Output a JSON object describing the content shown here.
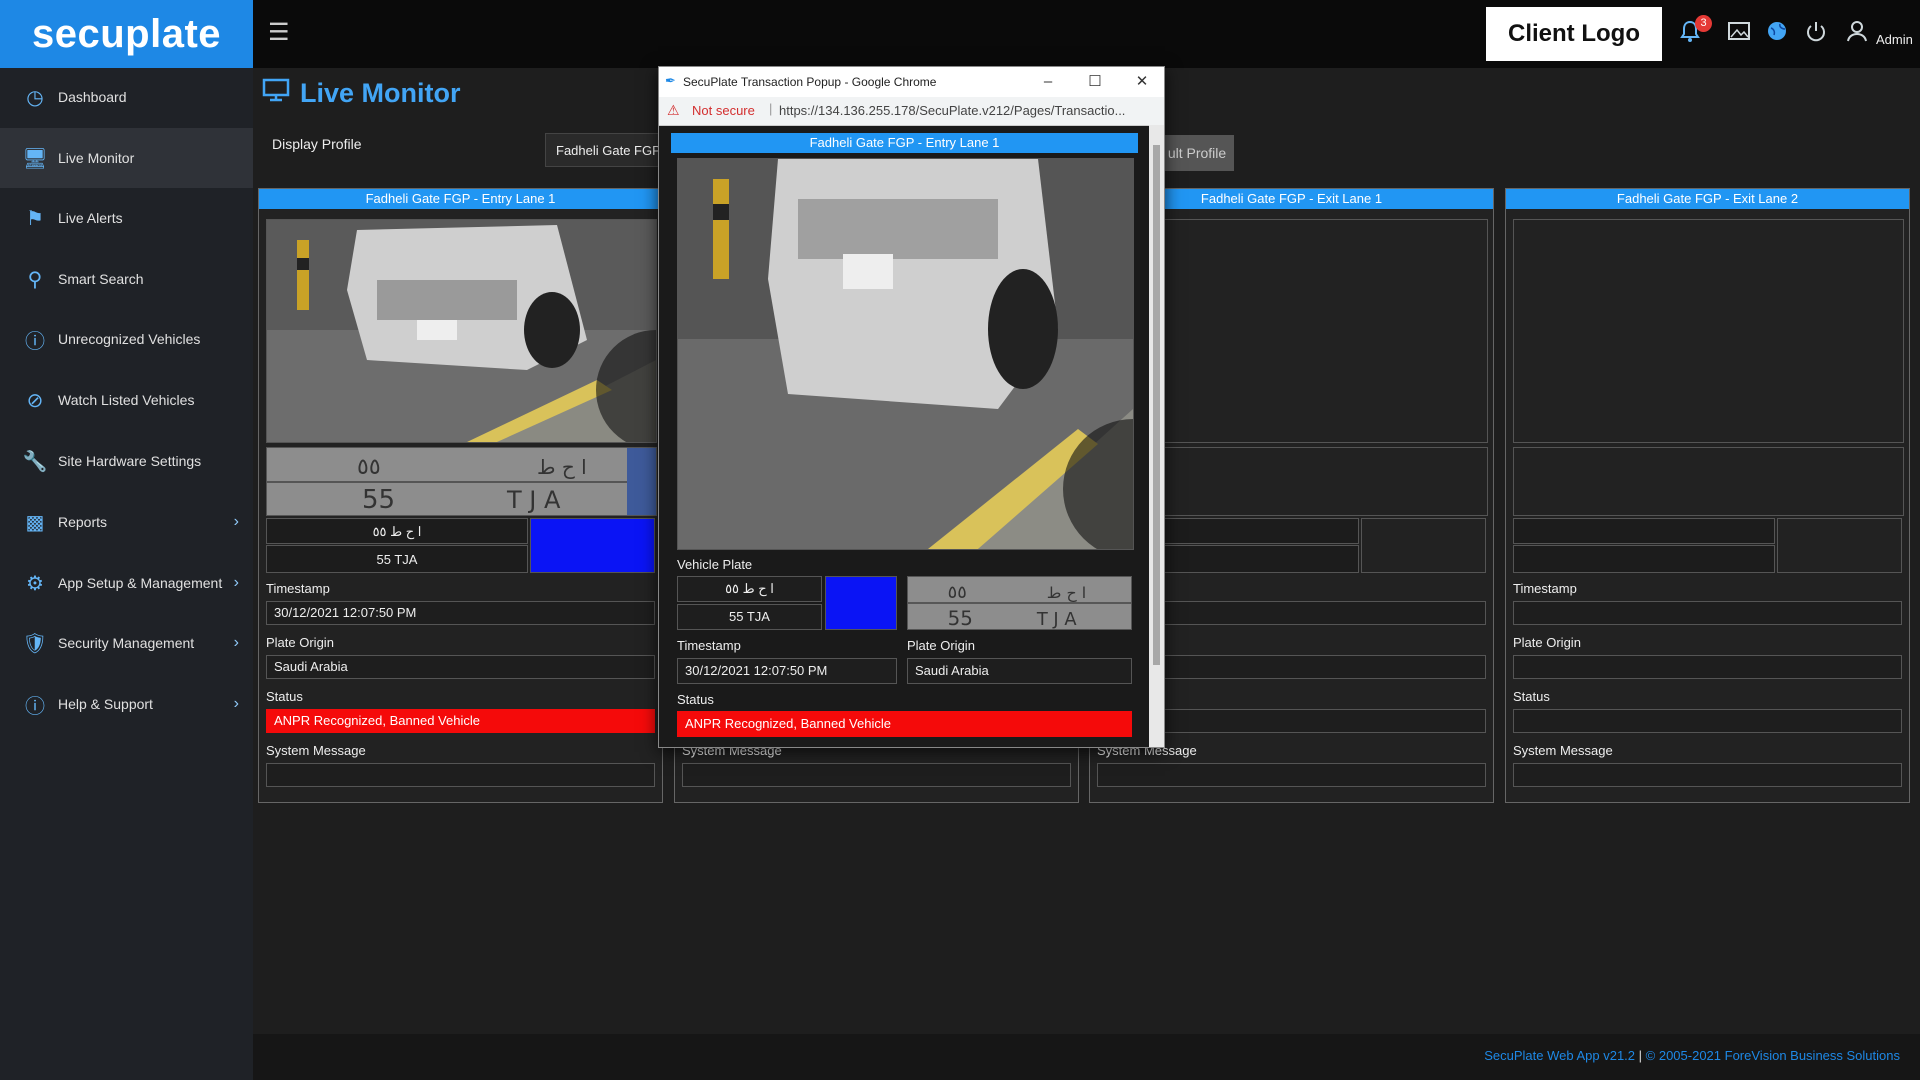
{
  "app": {
    "logo": "secuplate",
    "client_logo": "Client Logo",
    "notification_count": "3",
    "user_label": "Admin"
  },
  "sidebar": {
    "items": [
      {
        "label": "Dashboard",
        "icon": "dashboard-gauge-icon"
      },
      {
        "label": "Live Monitor",
        "icon": "monitor-icon",
        "active": true
      },
      {
        "label": "Live Alerts",
        "icon": "flag-icon"
      },
      {
        "label": "Smart Search",
        "icon": "search-icon"
      },
      {
        "label": "Unrecognized Vehicles",
        "icon": "question-circle-icon"
      },
      {
        "label": "Watch Listed Vehicles",
        "icon": "ban-icon"
      },
      {
        "label": "Site Hardware Settings",
        "icon": "wrench-icon"
      },
      {
        "label": "Reports",
        "icon": "bar-chart-icon",
        "has_submenu": true
      },
      {
        "label": "App Setup & Management",
        "icon": "gear-icon",
        "has_submenu": true
      },
      {
        "label": "Security Management",
        "icon": "shield-icon",
        "has_submenu": true
      },
      {
        "label": "Help & Support",
        "icon": "info-icon",
        "has_submenu": true
      }
    ]
  },
  "main": {
    "title": "Live Monitor",
    "display_profile_label": "Display Profile",
    "display_profile_value": "Fadheli Gate FGP",
    "default_profile_button": "ult Profile",
    "lanes": [
      {
        "header": "Fadheli Gate FGP - Entry Lane 1",
        "plate_arabic": "ا ح ط ٥٥",
        "plate_english": "55 TJA",
        "plate_color": "#0a14f5",
        "timestamp_label": "Timestamp",
        "timestamp": "30/12/2021 12:07:50 PM",
        "plate_origin_label": "Plate Origin",
        "plate_origin": "Saudi Arabia",
        "status_label": "Status",
        "status": "ANPR Recognized, Banned Vehicle",
        "system_message_label": "System Message",
        "system_message": ""
      },
      {
        "header": "",
        "system_message_label": "System Message"
      },
      {
        "header": "Fadheli Gate FGP - Exit Lane 1",
        "status_label_partial": "",
        "plate_origin_label_partial": "n",
        "system_message_label": "System Message"
      },
      {
        "header": "Fadheli Gate FGP - Exit Lane 2",
        "timestamp_label": "Timestamp",
        "plate_origin_label": "Plate Origin",
        "status_label": "Status",
        "system_message_label": "System Message"
      }
    ]
  },
  "popup": {
    "window_title": "SecuPlate Transaction Popup - Google Chrome",
    "not_secure": "Not secure",
    "url": "https://134.136.255.178/SecuPlate.v212/Pages/Transactio...",
    "header": "Fadheli Gate FGP - Entry Lane 1",
    "vehicle_plate_label": "Vehicle Plate",
    "plate_arabic": "ا ح ط ٥٥",
    "plate_english": "55 TJA",
    "plate_color": "#0a14f5",
    "timestamp_label": "Timestamp",
    "timestamp": "30/12/2021 12:07:50 PM",
    "plate_origin_label": "Plate Origin",
    "plate_origin": "Saudi Arabia",
    "status_label": "Status",
    "status": "ANPR Recognized, Banned Vehicle"
  },
  "footer": {
    "app_version": "SecuPlate Web App v21.2",
    "separator": "|",
    "copyright": "© 2005-2021",
    "company": "ForeVision Business Solutions"
  },
  "colors": {
    "accent": "#1e88e5",
    "lane_header": "#2196f3",
    "status_banned": "#f50a0a",
    "sidebar_bg": "#1f2227"
  }
}
